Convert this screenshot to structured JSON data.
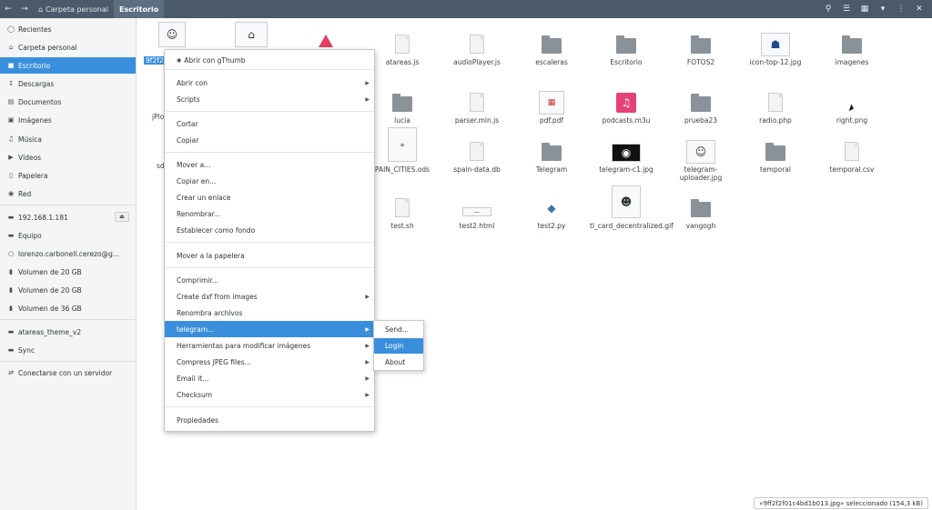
{
  "header": {
    "crumbs": [
      "Carpeta personal",
      "Escritorio"
    ]
  },
  "sidebar": {
    "items": [
      {
        "label": "Recientes",
        "icon": "clock-icon"
      },
      {
        "label": "Carpeta personal",
        "icon": "home-icon"
      },
      {
        "label": "Escritorio",
        "icon": "desktop-icon"
      },
      {
        "label": "Descargas",
        "icon": "download-icon"
      },
      {
        "label": "Documentos",
        "icon": "document-icon"
      },
      {
        "label": "Imágenes",
        "icon": "image-icon"
      },
      {
        "label": "Música",
        "icon": "music-icon"
      },
      {
        "label": "Vídeos",
        "icon": "video-icon"
      },
      {
        "label": "Papelera",
        "icon": "trash-icon"
      },
      {
        "label": "Red",
        "icon": "network-icon"
      },
      {
        "label": "192.168.1.181",
        "icon": "drive-icon"
      },
      {
        "label": "Equipo",
        "icon": "computer-icon"
      },
      {
        "label": "lorenzo.carbonell.cerezo@g...",
        "icon": "account-icon"
      },
      {
        "label": "Volumen de 20 GB",
        "icon": "drive-icon"
      },
      {
        "label": "Volumen de 20 GB",
        "icon": "drive-icon"
      },
      {
        "label": "Volumen de 36 GB",
        "icon": "drive-icon"
      },
      {
        "label": "atareas_theme_v2",
        "icon": "folder-icon"
      },
      {
        "label": "Sync",
        "icon": "folder-icon"
      },
      {
        "label": "Conectarse con un servidor",
        "icon": "connect-icon"
      }
    ]
  },
  "files": {
    "row1": [
      "atareas.js",
      "audioPlayer.js",
      "escaleras",
      "Escritorio",
      "FOTOS2",
      "icon-top-12.jpg",
      "imagenes"
    ],
    "row2": [
      "lucia",
      "parser.min.js",
      "pdf.pdf",
      "podcasts.m3u",
      "prueba23",
      "radio.php",
      "right.png"
    ],
    "row3": [
      "PAIN_CITIES.ods",
      "spain-data.db",
      "Telegram",
      "telegram-c1.jpg",
      "telegram-uploader.jpg",
      "temporal",
      "temporal.csv"
    ],
    "row4": [
      "test.sh",
      "test2.html",
      "test2.py",
      "tl_card_decentralized.gif",
      "vangogh"
    ],
    "partials": [
      "9f2f2",
      "jPlo",
      "sd"
    ]
  },
  "context_menu": {
    "items": [
      "Abrir con gThumb",
      "Abrir con",
      "Scripts",
      "Cortar",
      "Copiar",
      "Mover a...",
      "Copiar en...",
      "Crear un enlace",
      "Renombrar...",
      "Establecer como fondo",
      "Mover a la papelera",
      "Comprimir...",
      "Create dxf from images",
      "Renombra archivos",
      "telegram...",
      "Herramientas para modificar imágenes",
      "Compress JPEG files...",
      "Email it...",
      "Checksum",
      "Propiedades"
    ]
  },
  "submenu": {
    "items": [
      "Send...",
      "Login",
      "About"
    ]
  },
  "status": {
    "text": "«9ff2f2f01c4bd1b013.jpg» seleccionado (154,3 kB)"
  },
  "colors": {
    "accent": "#3a8fdc",
    "header_bg": "#4a5a6a"
  }
}
